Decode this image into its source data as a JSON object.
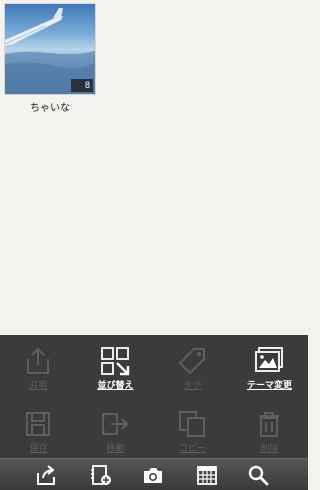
{
  "album": {
    "title": "ちゃいな",
    "count": "8",
    "thumbnail_subject": "airplane wing above clouds"
  },
  "actions": [
    {
      "label": "共有",
      "icon": "share-icon",
      "enabled": false
    },
    {
      "label": "並び替え",
      "icon": "grid-sort-icon",
      "enabled": true
    },
    {
      "label": "タグ",
      "icon": "tag-icon",
      "enabled": false
    },
    {
      "label": "テーマ変更",
      "icon": "picture-frame-icon",
      "enabled": true
    },
    {
      "label": "保存",
      "icon": "save-icon",
      "enabled": false
    },
    {
      "label": "移動",
      "icon": "move-icon",
      "enabled": false
    },
    {
      "label": "コピー",
      "icon": "copy-icon",
      "enabled": false
    },
    {
      "label": "削除",
      "icon": "trash-icon",
      "enabled": false
    }
  ],
  "toolbar": {
    "items": [
      "share-icon",
      "add-album-icon",
      "camera-icon",
      "calendar-icon",
      "search-icon"
    ]
  },
  "colors": {
    "background": "#f4f2ef",
    "panel": "#3b3b3a",
    "enabled_text": "#ffffff",
    "disabled_text": "#5e5e5d"
  }
}
